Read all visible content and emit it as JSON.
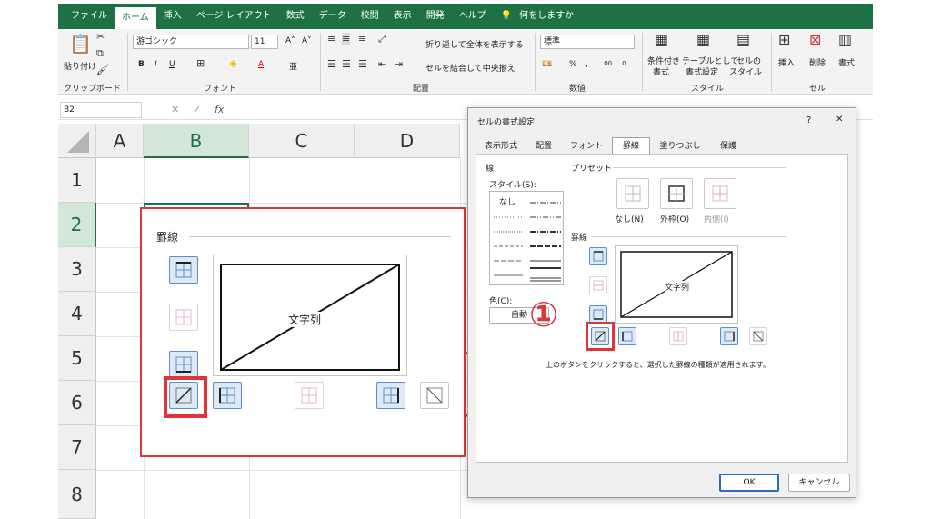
{
  "ribbon_tabs": [
    "ファイル",
    "ホーム",
    "挿入",
    "ページ レイアウト",
    "数式",
    "データ",
    "校閲",
    "表示",
    "開発",
    "ヘルプ",
    "何をしますか"
  ],
  "ribbon": {
    "paste": "貼り付け",
    "clipboard": "クリップボード",
    "font_name": "游ゴシック",
    "font_size": "11",
    "font_group": "フォント",
    "wrap_text": "折り返して全体を表示する",
    "merge_center": "セルを結合して中央揃え",
    "alignment_group": "配置",
    "number_format": "標準",
    "number_group": "数値",
    "conditional": "条件付き",
    "conditional_2": "書式",
    "table_format": "テーブルとして",
    "table_format_2": "書式設定",
    "cell_style": "セルの",
    "cell_style_2": "スタイル",
    "styles_group": "スタイル",
    "insert": "挿入",
    "delete": "削除",
    "format": "書式",
    "cells_group": "セル"
  },
  "formula_bar": {
    "name_box": "B2",
    "fx": "fx"
  },
  "sheet": {
    "columns": [
      "A",
      "B",
      "C",
      "D"
    ],
    "rows": [
      "1",
      "2",
      "3",
      "4",
      "5",
      "6",
      "7",
      "8"
    ]
  },
  "callout": {
    "section_title": "罫線",
    "preview_text": "文字列"
  },
  "dialog": {
    "title": "セルの書式設定",
    "help": "?",
    "close": "✕",
    "tabs": [
      "表示形式",
      "配置",
      "フォント",
      "罫線",
      "塗りつぶし",
      "保護"
    ],
    "line_section": "線",
    "style_label": "スタイル(S):",
    "style_none": "なし",
    "color_label": "色(C):",
    "color_value": "自動",
    "preset_section": "プリセット",
    "preset_none": "なし(N)",
    "preset_outline": "外枠(O)",
    "preset_inside": "内側(I)",
    "border_section": "罫線",
    "preview_text": "文字列",
    "hint": "上のボタンをクリックすると、選択した罫線の種類が適用されます。",
    "ok": "OK",
    "cancel": "キャンセル"
  },
  "annotation": {
    "step": "①"
  },
  "colors": {
    "accent": "#1e7145",
    "highlight": "#e0333a",
    "selected_button": "#5a8fca"
  }
}
